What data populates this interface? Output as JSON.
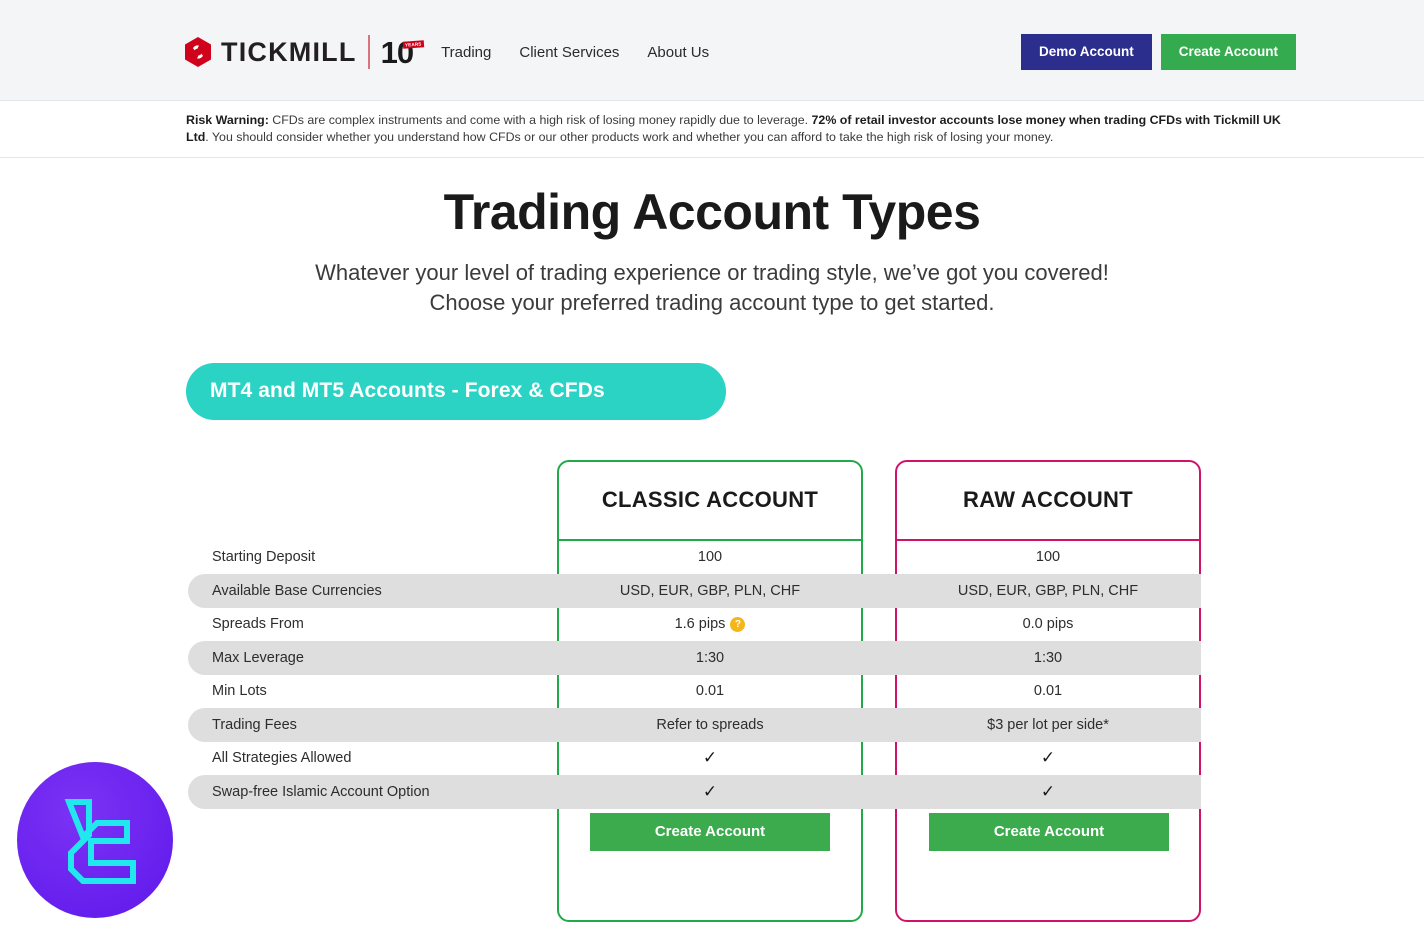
{
  "header": {
    "logo": {
      "brand": "TICKMILL",
      "anniversary": "10",
      "badge_text": "YEARS",
      "mark_icon": "tickmill-hexagon-logo-icon"
    },
    "nav": [
      {
        "label": "Trading"
      },
      {
        "label": "Client Services"
      },
      {
        "label": "About Us"
      }
    ],
    "demo_button": "Demo Account",
    "create_button": "Create Account",
    "colors": {
      "demo_bg": "#2b2e8c",
      "create_bg": "#33ab4e",
      "band_bg": "#f4f5f7",
      "logo_red": "#d0021b"
    }
  },
  "risk_warning": {
    "bold_lead": "Risk Warning:",
    "text_1": " CFDs are complex instruments and come with a high risk of losing money rapidly due to leverage. ",
    "bold_1": "72% of retail investor accounts lose money when trading CFDs with Tickmill UK Ltd",
    "text_2": ". You should consider whether you understand how CFDs or our other products work and whether you can afford to take the high risk of losing your money."
  },
  "hero": {
    "title": "Trading Account Types",
    "subtitle_line_1": "Whatever your level of trading experience or trading style, we’ve got you covered!",
    "subtitle_line_2": "Choose your preferred trading account type to get started."
  },
  "tab_pill": {
    "label": "MT4 and MT5 Accounts - Forex & CFDs",
    "color": "#2ad3c4"
  },
  "comparison": {
    "columns": [
      {
        "title": "CLASSIC ACCOUNT",
        "accent": "#22a94a",
        "cta_label": "Create Account"
      },
      {
        "title": "RAW ACCOUNT",
        "accent": "#d0136a",
        "cta_label": "Create Account"
      }
    ],
    "rows": [
      {
        "label": "Starting Deposit",
        "classic": "100",
        "raw": "100",
        "striped": false,
        "type": "text"
      },
      {
        "label": "Available Base Currencies",
        "classic": "USD, EUR, GBP, PLN, CHF",
        "raw": "USD, EUR, GBP, PLN, CHF",
        "striped": true,
        "type": "text"
      },
      {
        "label": "Spreads From",
        "classic": "1.6 pips",
        "raw": "0.0 pips",
        "striped": false,
        "type": "text",
        "classic_info_icon": "help-question-icon"
      },
      {
        "label": "Max Leverage",
        "classic": "1:30",
        "raw": "1:30",
        "striped": true,
        "type": "text"
      },
      {
        "label": "Min Lots",
        "classic": "0.01",
        "raw": "0.01",
        "striped": false,
        "type": "text"
      },
      {
        "label": "Trading Fees",
        "classic": "Refer to spreads",
        "raw": "$3 per lot per side*",
        "striped": true,
        "type": "text"
      },
      {
        "label": "All Strategies Allowed",
        "classic": "✓",
        "raw": "✓",
        "striped": false,
        "type": "check"
      },
      {
        "label": "Swap-free Islamic Account Option",
        "classic": "✓",
        "raw": "✓",
        "striped": true,
        "type": "check"
      }
    ]
  },
  "corner_badge": {
    "icon": "lc-monogram-logo-icon",
    "circle_color": "#6a22ef",
    "glyph_color": "#21e8ef"
  }
}
